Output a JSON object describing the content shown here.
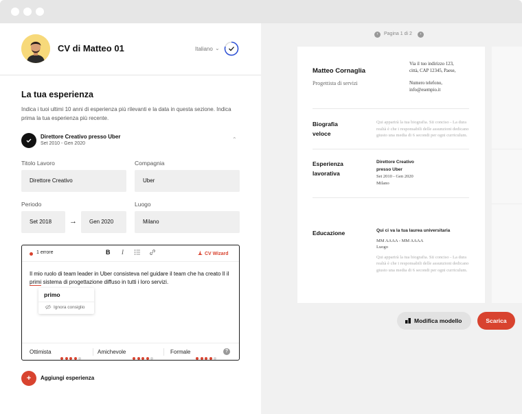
{
  "header": {
    "cv_title": "CV di Matteo 01",
    "language": "Italiano"
  },
  "section": {
    "title": "La tua esperienza",
    "description": "Indica i tuoi ultimi 10 anni di esperienza più rilevanti e la data in questa sezione. Indica prima la tua esperienza più recente."
  },
  "experience": {
    "title": "Direttore Creativo presso Uber",
    "dates": "Set 2010 - Gen 2020",
    "fields": {
      "job_title_label": "Titolo Lavoro",
      "job_title_value": "Direttore Creativo",
      "company_label": "Compagnia",
      "company_value": "Uber",
      "period_label": "Periodo",
      "period_start": "Set 2018",
      "period_end": "Gen 2020",
      "location_label": "Luogo",
      "location_value": "Milano"
    }
  },
  "editor": {
    "error_count": "1 errore",
    "bold": "B",
    "italic": "I",
    "wizard": "CV Wizard",
    "text_before": "Il mio ruolo di team leader in Uber consisteva nel guidare il team che ha creato Il il ",
    "error_word": "primi",
    "text_after": " sistema di progettazione diffuso in tutti i loro servizi.",
    "suggestion": "primo",
    "ignore": "Ignora consiglio",
    "tones": [
      {
        "label": "Ottimista",
        "level": 4,
        "max": 5
      },
      {
        "label": "Amichevole",
        "level": 4,
        "max": 5
      },
      {
        "label": "Formale",
        "level": 4,
        "max": 5
      }
    ],
    "help": "?"
  },
  "add_experience": {
    "icon": "+",
    "label": "Aggiungi esperienza"
  },
  "preview": {
    "pager": "Pagina 1 di 2",
    "name": "Matteo Cornaglia",
    "role": "Progettista di servizi",
    "contact_address": "Via il tuo indirizzo 123, città, CAP 12345, Paese,",
    "contact_phone": "Numero telefono,",
    "contact_email": "info@esempio.it",
    "bio_title": "Biografia veloce",
    "bio_text": "Qui apparirà la tua biografia. Sii conciso - La dura realtà è che i responsabili delle assunzioni dedicano giusto una media di 6 secondi per ogni curriculum.",
    "exp_title": "Esperienza lavorativa",
    "exp_role": "Direttore Creativo presso Uber",
    "exp_dates": "Set 2010 - Gen 2020",
    "exp_city": "Milano",
    "edu_title": "Educazione",
    "edu_degree": "Qui ci va la tua laurea universitaria",
    "edu_dates": "MM AAAA - MM AAAA",
    "edu_place": "Luogo",
    "edu_text": "Qui apparirà la tua biografia. Sii conciso - La dura realtà è che i responsabili delle assunzioni dedicano giusto una media di 6 secondi per ogni curriculum."
  },
  "actions": {
    "edit_template": "Modifica modello",
    "download": "Scarica"
  },
  "colors": {
    "accent": "#d8432f",
    "avatar_bg": "#f7d97a"
  }
}
